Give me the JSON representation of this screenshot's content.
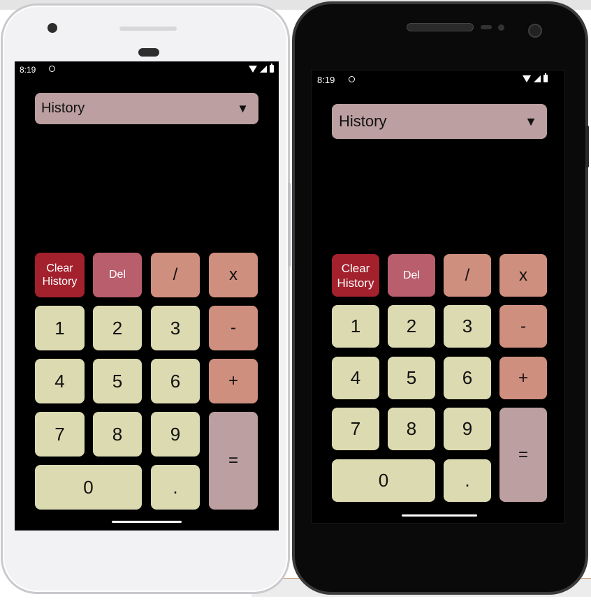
{
  "status": {
    "time": "8:19"
  },
  "history_dropdown": {
    "label": "History",
    "arrow": "▼"
  },
  "keys": {
    "clear_history": "Clear History",
    "del": "Del",
    "divide": "/",
    "multiply": "x",
    "one": "1",
    "two": "2",
    "three": "3",
    "minus": "-",
    "four": "4",
    "five": "5",
    "six": "6",
    "plus": "+",
    "seven": "7",
    "eight": "8",
    "nine": "9",
    "equals": "=",
    "zero": "0",
    "decimal": "."
  },
  "colors": {
    "number_key": "#dcdab0",
    "operator_key": "#cf8f7e",
    "clear_key": "#a3212d",
    "del_key": "#b85e6c",
    "equals_key": "#bc9fa0",
    "dropdown": "#bc9fa0"
  }
}
